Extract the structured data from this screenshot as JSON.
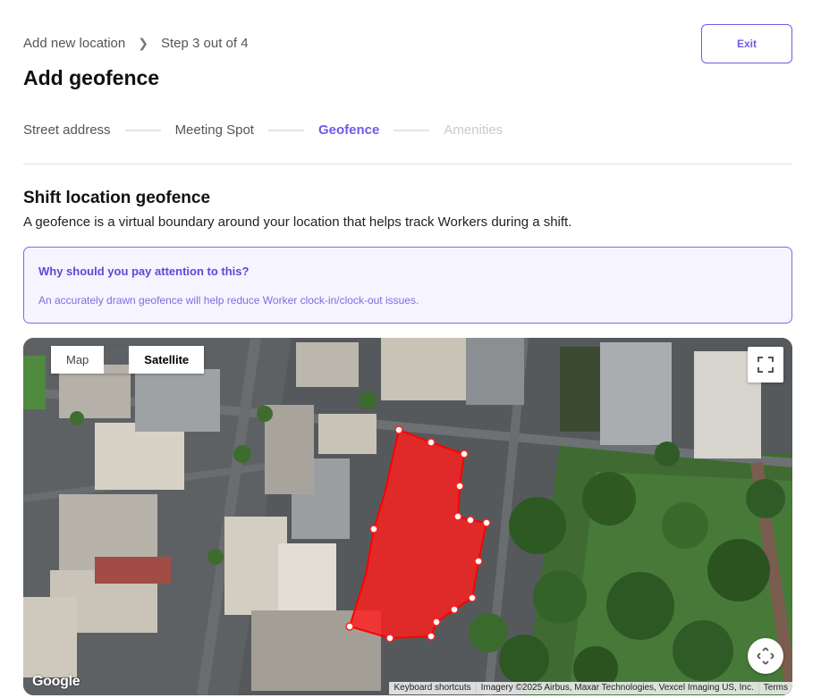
{
  "breadcrumb": {
    "parent": "Add new location",
    "current": "Step 3 out of 4"
  },
  "header": {
    "exit_label": "Exit",
    "title": "Add geofence"
  },
  "steps": [
    {
      "label": "Street address",
      "state": "done"
    },
    {
      "label": "Meeting Spot",
      "state": "done"
    },
    {
      "label": "Geofence",
      "state": "active"
    },
    {
      "label": "Amenities",
      "state": "disabled"
    }
  ],
  "section": {
    "title": "Shift location geofence",
    "description": "A geofence is a virtual boundary around your location that helps track Workers during a shift."
  },
  "notice": {
    "title": "Why should you pay attention to this?",
    "body": "An accurately drawn geofence will help reduce Worker clock-in/clock-out issues."
  },
  "map": {
    "type_buttons": {
      "map": "Map",
      "satellite": "Satellite"
    },
    "selected_type": "Satellite",
    "google_logo": "Google",
    "attribution": {
      "shortcuts": "Keyboard shortcuts",
      "imagery": "Imagery ©2025 Airbus, Maxar Technologies, Vexcel Imaging US, Inc.",
      "terms": "Terms"
    },
    "icons": {
      "fullscreen": "fullscreen-icon",
      "pan": "pan-arrows-icon"
    },
    "geofence_color": "#ff1f1f"
  },
  "colors": {
    "accent": "#6b5ce7",
    "notice_bg": "#f6f4ff"
  }
}
